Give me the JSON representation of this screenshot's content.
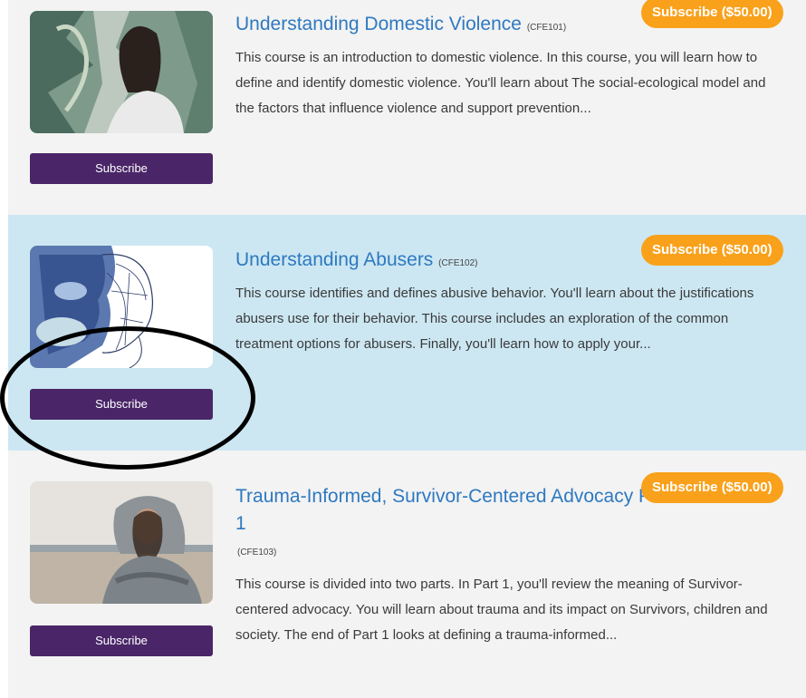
{
  "courses": [
    {
      "title": "Understanding Domestic Violence",
      "code": "(CFE101)",
      "description": "This course is an introduction to domestic violence. In this course, you will learn how to define and identify domestic violence. You'll learn about The social-ecological model and the factors that influence violence and support prevention...",
      "price_label": "Subscribe ($50.00)",
      "button_label": "Subscribe",
      "image": "woman-against-graffiti-wall-photo"
    },
    {
      "title": "Understanding Abusers",
      "code": "(CFE102)",
      "description": "This course identifies and defines abusive behavior. You'll learn about the justifications abusers use for their behavior. This course includes an exploration of the common treatment options for abusers. Finally, you'll learn how to apply your...",
      "price_label": "Subscribe ($50.00)",
      "button_label": "Subscribe",
      "image": "blue-face-sketch-illustration"
    },
    {
      "title": "Trauma-Informed, Survivor-Centered Advocacy Part 1",
      "code": "(CFE103)",
      "description": "This course is divided into two parts. In Part 1, you'll review the meaning of Survivor-centered advocacy. You will learn about trauma and its impact on Survivors, children and society. The end of Part 1 looks at defining a trauma-informed...",
      "price_label": "Subscribe ($50.00)",
      "button_label": "Subscribe",
      "image": "woman-in-hoodie-on-beach-photo"
    }
  ],
  "colors": {
    "title": "#2e79c0",
    "button": "#4a2668",
    "price_badge": "#f9a11b",
    "row_highlight": "#cce7f2",
    "row_default": "#f3f3f3"
  }
}
